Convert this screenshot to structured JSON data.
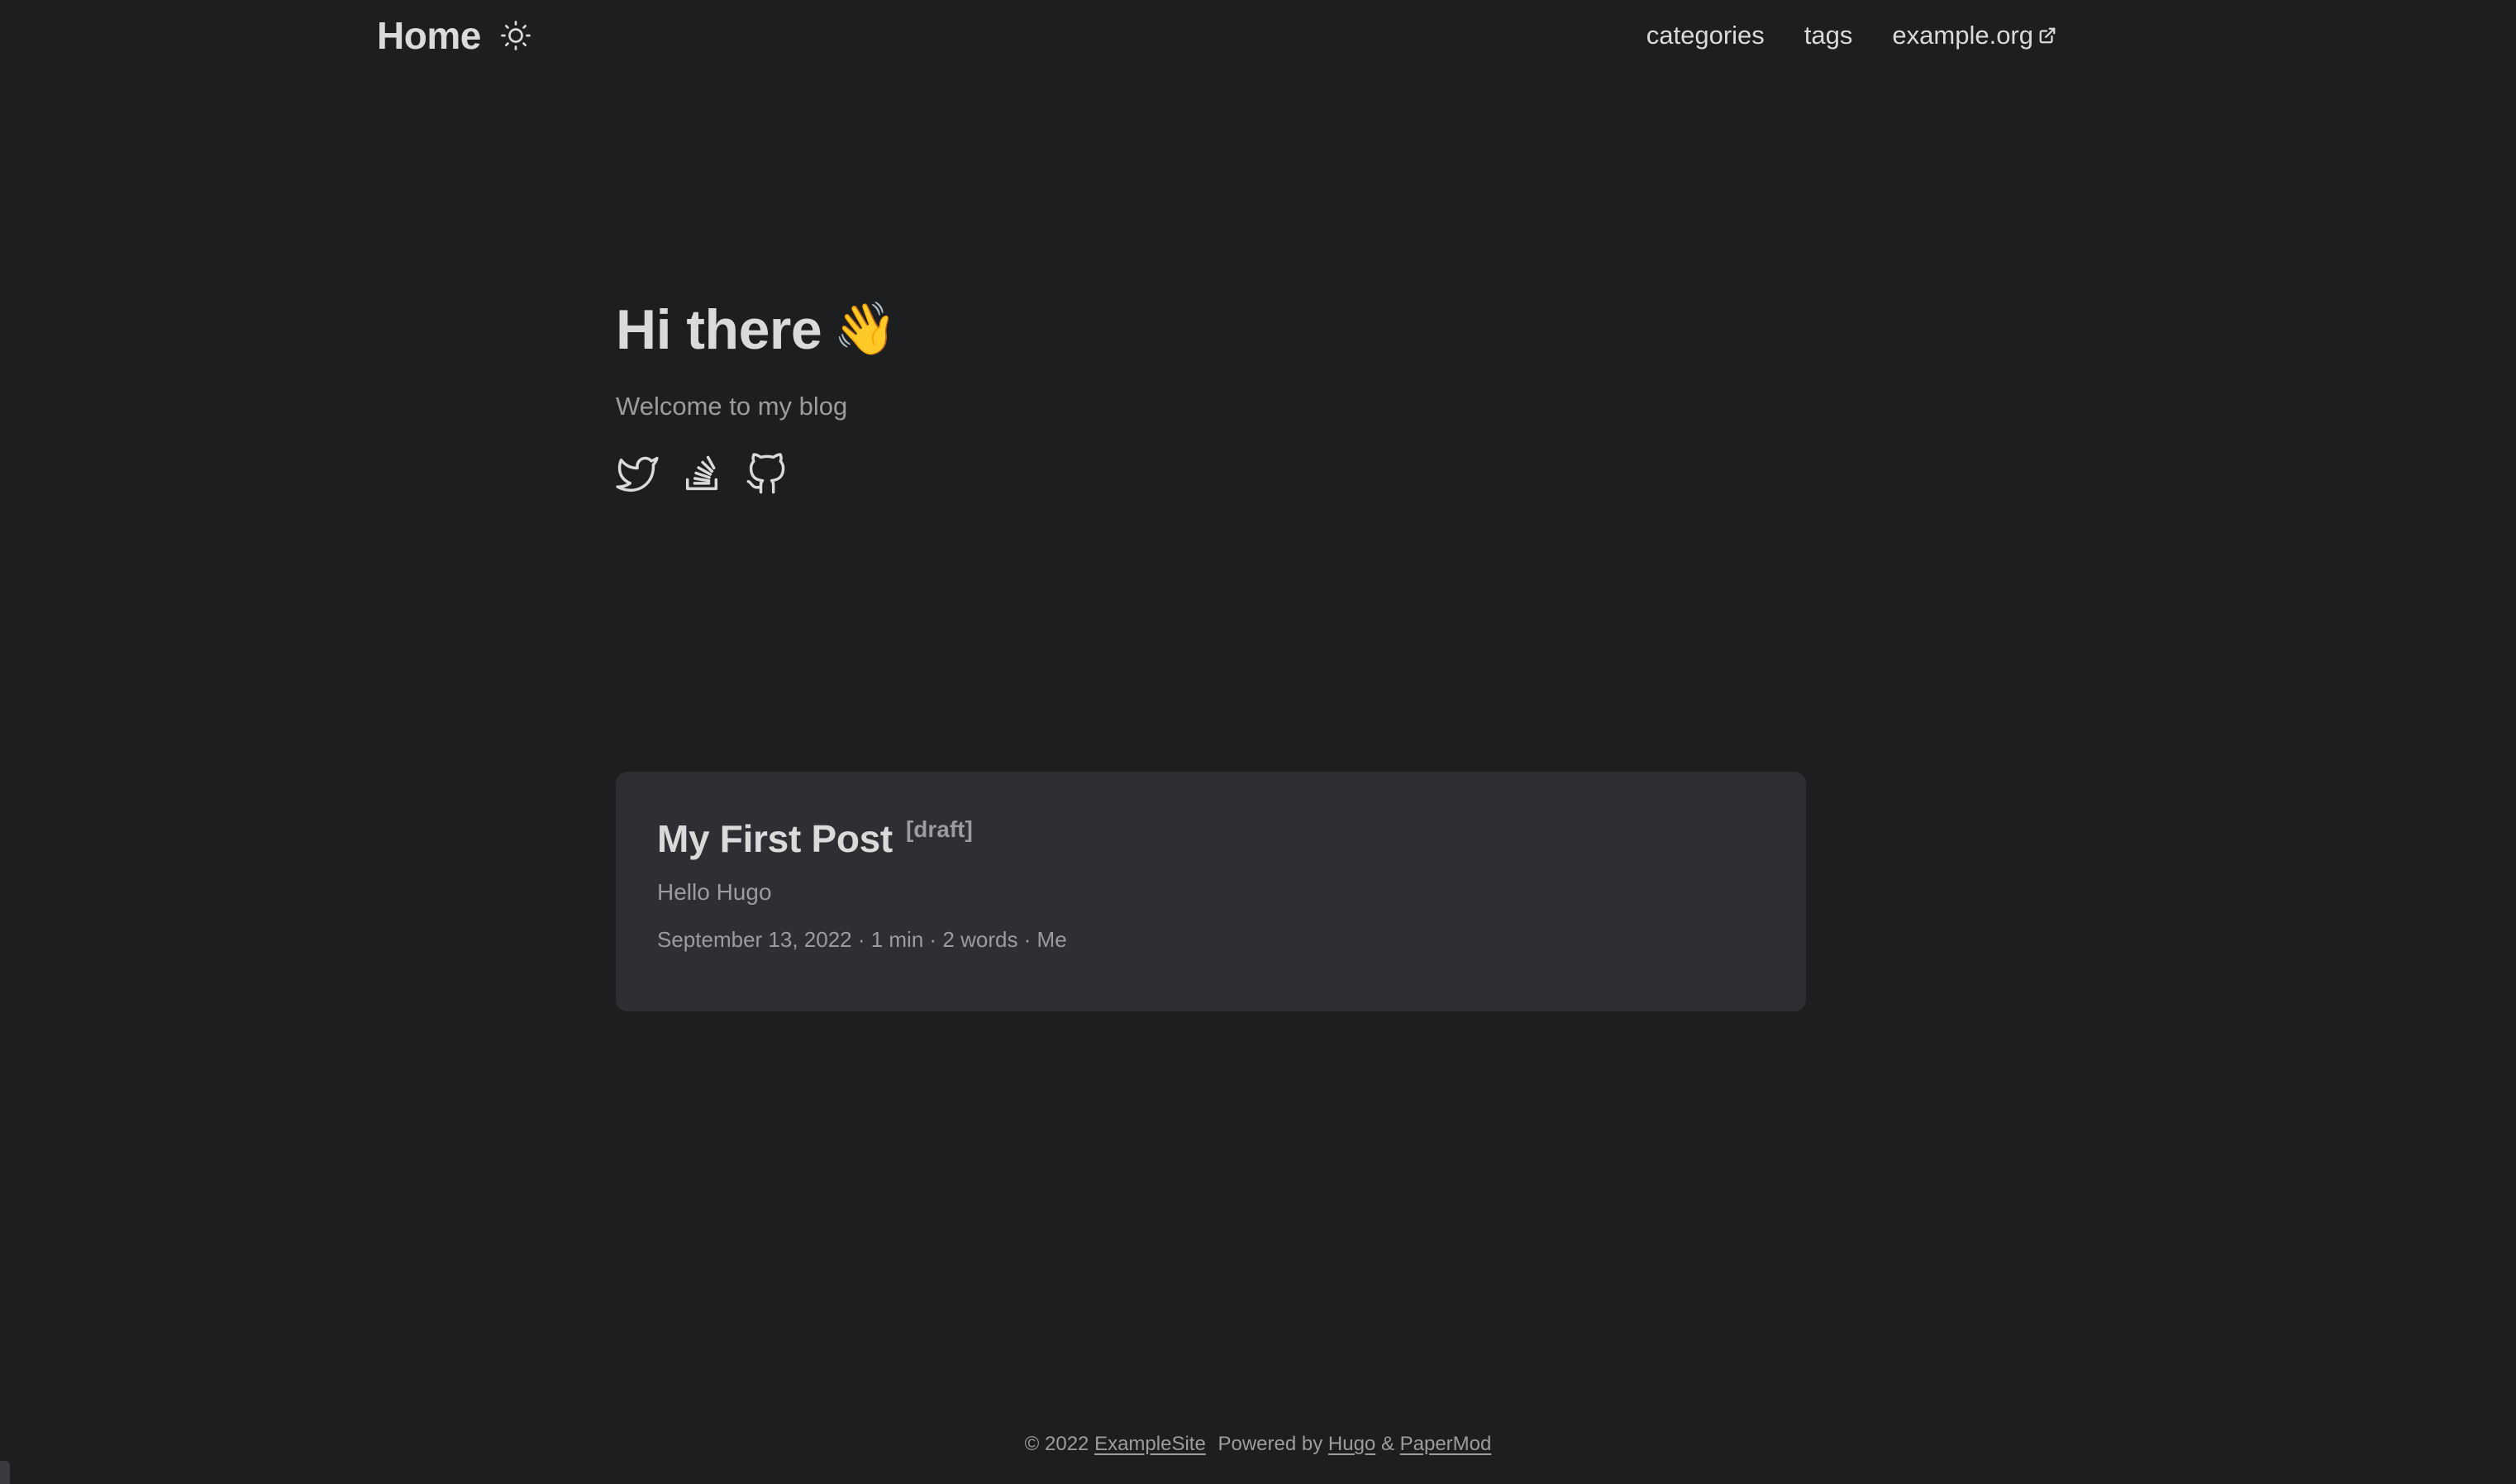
{
  "header": {
    "logo": "Home",
    "theme_toggle_icon": "sun-icon",
    "nav": [
      {
        "label": "categories"
      },
      {
        "label": "tags"
      },
      {
        "label": "example.org",
        "icon": "external-link-icon"
      }
    ]
  },
  "profile": {
    "title": "Hi there",
    "emoji": "👋",
    "subtitle": "Welcome to my blog",
    "social": [
      {
        "icon": "twitter-icon"
      },
      {
        "icon": "stackoverflow-icon"
      },
      {
        "icon": "github-icon"
      }
    ]
  },
  "post": {
    "title": "My First Post",
    "badge": "[draft]",
    "summary": "Hello Hugo",
    "meta": "September 13, 2022 · 1 min · 2 words · Me"
  },
  "footer": {
    "copyright": "© 2022",
    "site_name": "ExampleSite",
    "powered_by": "Powered by",
    "hugo": "Hugo",
    "amp": "&",
    "theme": "PaperMod"
  },
  "colors": {
    "background": "#1d1e20",
    "card": "#2e2e33",
    "primary_text": "#dadadb",
    "secondary_text": "#9b9c9d"
  }
}
